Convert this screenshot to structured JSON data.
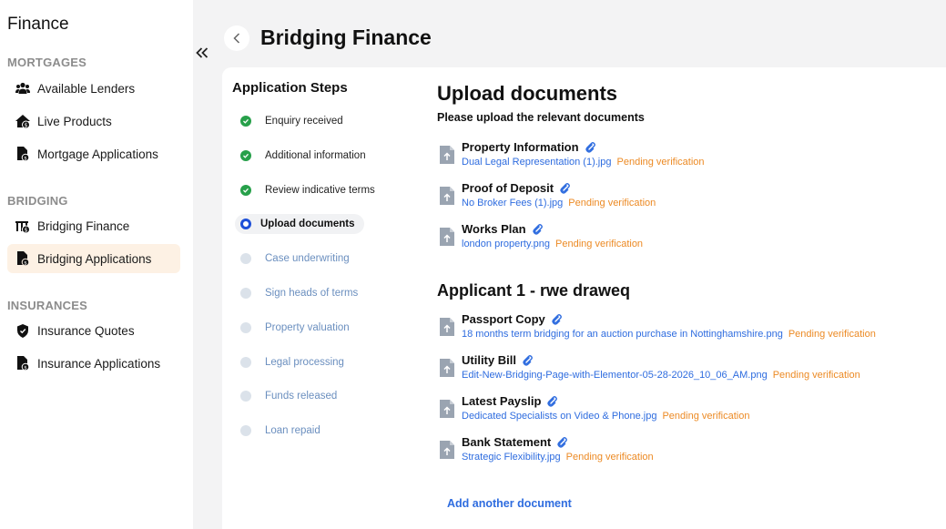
{
  "sidebar": {
    "brand": "Finance",
    "sections": [
      {
        "title": "MORTGAGES",
        "items": [
          {
            "label": "Available Lenders",
            "icon": "users-icon"
          },
          {
            "label": "Live Products",
            "icon": "home-dollar-icon"
          },
          {
            "label": "Mortgage Applications",
            "icon": "document-dollar-icon"
          }
        ]
      },
      {
        "title": "BRIDGING",
        "items": [
          {
            "label": "Bridging Finance",
            "icon": "bridge-dollar-icon"
          },
          {
            "label": "Bridging Applications",
            "icon": "document-dollar-icon",
            "active": true
          }
        ]
      },
      {
        "title": "INSURANCES",
        "items": [
          {
            "label": "Insurance Quotes",
            "icon": "shield-icon"
          },
          {
            "label": "Insurance Applications",
            "icon": "document-dollar-icon"
          }
        ]
      }
    ]
  },
  "header": {
    "title": "Bridging Finance"
  },
  "steps": {
    "title": "Application Steps",
    "items": [
      {
        "label": "Enquiry received",
        "state": "done"
      },
      {
        "label": "Additional information",
        "state": "done"
      },
      {
        "label": "Review indicative terms",
        "state": "done"
      },
      {
        "label": "Upload documents",
        "state": "current"
      },
      {
        "label": "Case underwriting",
        "state": "pending"
      },
      {
        "label": "Sign heads of terms",
        "state": "pending"
      },
      {
        "label": "Property valuation",
        "state": "pending"
      },
      {
        "label": "Legal processing",
        "state": "pending"
      },
      {
        "label": "Funds released",
        "state": "pending"
      },
      {
        "label": "Loan repaid",
        "state": "pending"
      }
    ]
  },
  "main": {
    "title": "Upload documents",
    "subtitle": "Please upload the relevant documents",
    "documents": [
      {
        "title": "Property Information",
        "file": "Dual Legal Representation (1).jpg",
        "status": "Pending verification"
      },
      {
        "title": "Proof of Deposit",
        "file": "No Broker Fees (1).jpg",
        "status": "Pending verification"
      },
      {
        "title": "Works Plan",
        "file": "london property.png",
        "status": "Pending verification"
      }
    ],
    "applicant_title": "Applicant 1 - rwe draweq",
    "applicant_documents": [
      {
        "title": "Passport Copy",
        "file": "18 months term bridging for an auction purchase in Nottinghamshire.png",
        "status": "Pending verification"
      },
      {
        "title": "Utility Bill",
        "file": "Edit-New-Bridging-Page-with-Elementor-05-28-2026_10_06_AM.png",
        "status": "Pending verification"
      },
      {
        "title": "Latest Payslip",
        "file": "Dedicated Specialists on Video & Phone.jpg",
        "status": "Pending verification"
      },
      {
        "title": "Bank Statement",
        "file": "Strategic Flexibility.jpg",
        "status": "Pending verification"
      }
    ],
    "add_label": "Add another document"
  },
  "colors": {
    "accent": "#2e6cdf",
    "pending_status": "#ec8a24",
    "step_done": "#27a04a",
    "step_current": "#1d4fd8",
    "active_nav_bg": "#fdf1e4"
  }
}
